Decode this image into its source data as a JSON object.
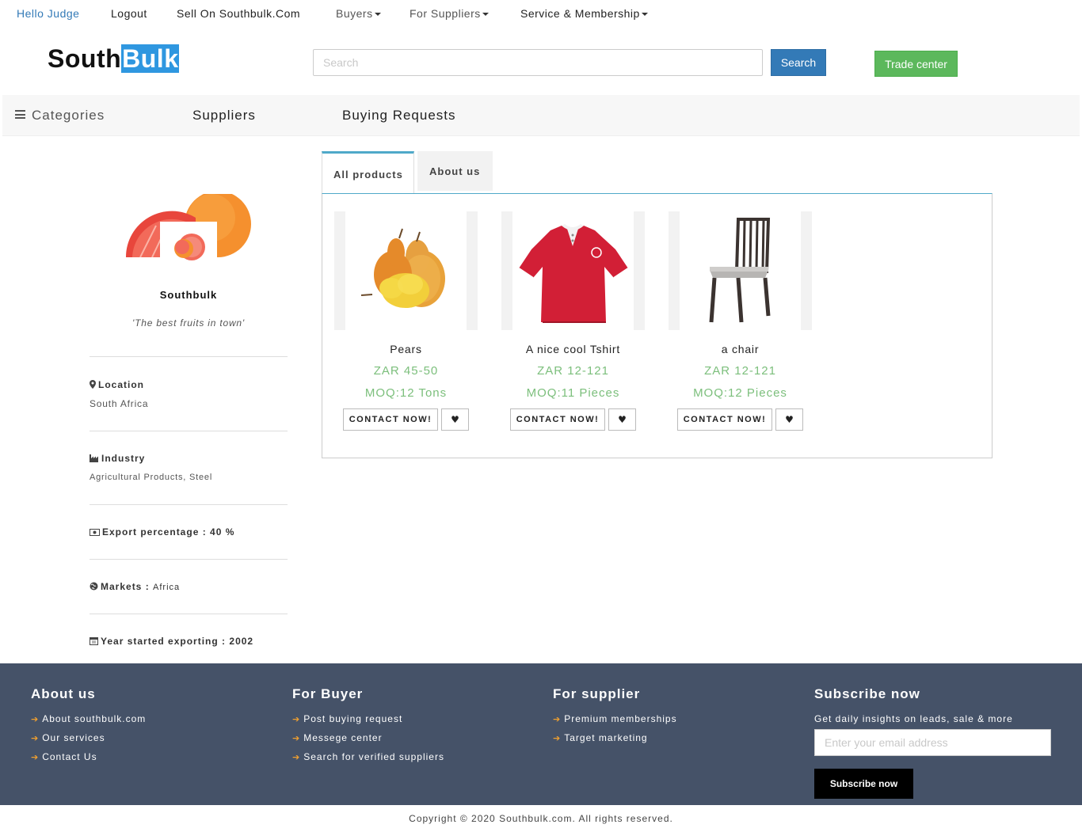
{
  "topnav": {
    "greeting": "Hello Judge",
    "logout": "Logout",
    "sell": "Sell On Southbulk.Com",
    "buyers": "Buyers",
    "suppliers": "For Suppliers",
    "service": "Service & Membership"
  },
  "header": {
    "logo_south": "South",
    "logo_bulk": "Bulk",
    "search_placeholder": "Search",
    "search_button": "Search",
    "trade_button": "Trade center"
  },
  "mainnav": {
    "categories": "Categories",
    "suppliers": "Suppliers",
    "buying_requests": "Buying Requests"
  },
  "profile": {
    "name": "Southbulk",
    "tagline": "'The best fruits in town'",
    "location_label": "Location",
    "location_value": "South Africa",
    "industry_label": "Industry",
    "industry_value": "Agricultural Products, Steel",
    "export_label": "Export percentage :",
    "export_value": "40 %",
    "markets_label": "Markets :",
    "markets_value": "Africa",
    "year_label": "Year started exporting :",
    "year_value": "2002"
  },
  "tabs": {
    "all_products": "All products",
    "about_us": "About us"
  },
  "products": [
    {
      "name": "Pears",
      "price": "ZAR 45-50",
      "moq": "MOQ:12 Tons",
      "contact": "CONTACT NOW!"
    },
    {
      "name": "A nice cool Tshirt",
      "price": "ZAR 12-121",
      "moq": "MOQ:11 Pieces",
      "contact": "CONTACT NOW!"
    },
    {
      "name": "a chair",
      "price": "ZAR 12-121",
      "moq": "MOQ:12 Pieces",
      "contact": "CONTACT NOW!"
    }
  ],
  "footer": {
    "about": {
      "title": "About us",
      "links": [
        "About southbulk.com",
        "Our services",
        "Contact Us"
      ]
    },
    "buyer": {
      "title": "For Buyer",
      "links": [
        "Post buying request",
        "Messege center",
        "Search for verified suppliers"
      ]
    },
    "supplier": {
      "title": "For supplier",
      "links": [
        "Premium memberships",
        "Target marketing"
      ]
    },
    "subscribe": {
      "title": "Subscribe now",
      "text": "Get daily insights on leads, sale & more",
      "email_placeholder": "Enter your email address",
      "button": "Subscribe now"
    }
  },
  "copyright": "Copyright © 2020 Southbulk.com. All rights reserved.",
  "colors": {
    "primary": "#337ab7",
    "success": "#5cb85c",
    "footer_bg": "#455268",
    "price_green": "#7cbf7c",
    "accent_arrow": "#f0a030",
    "tab_accent": "#4fa9c9"
  }
}
